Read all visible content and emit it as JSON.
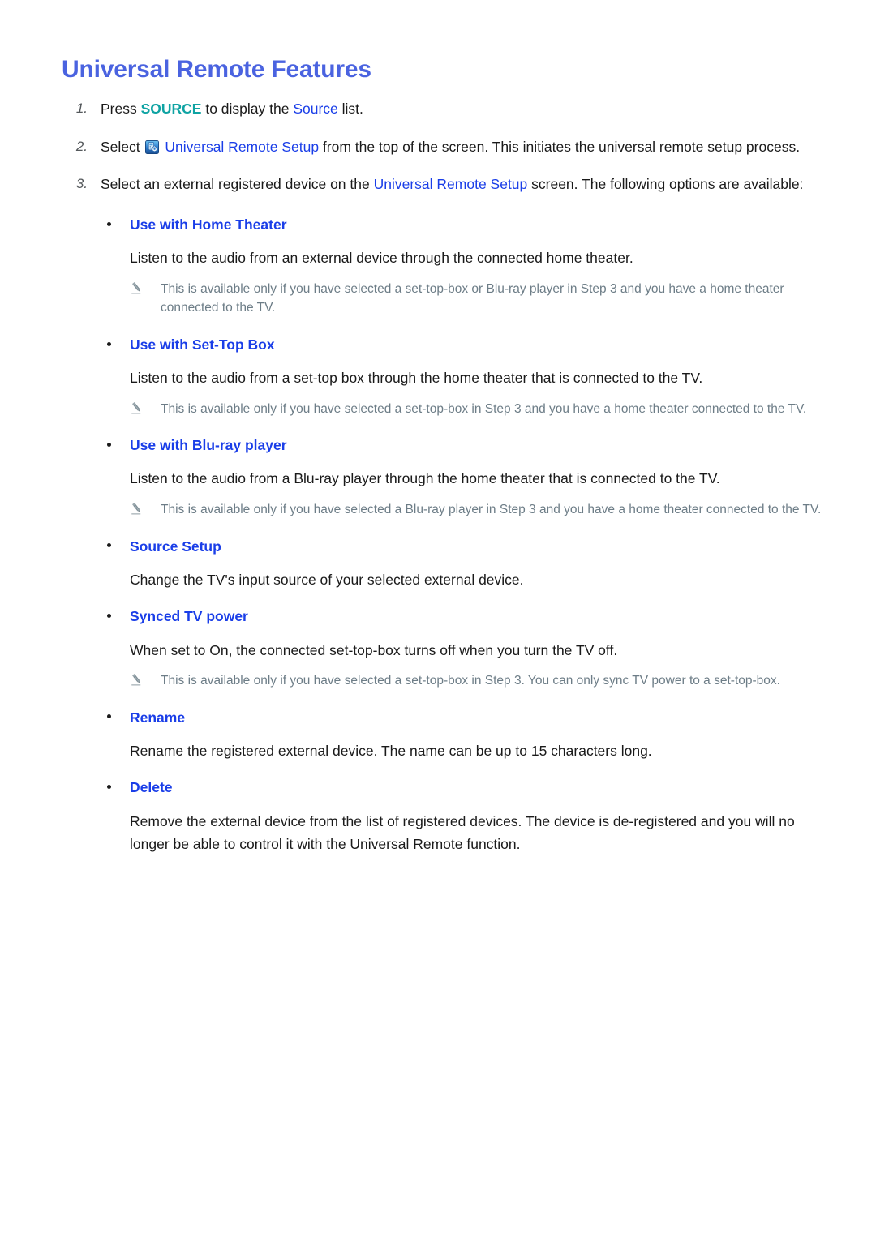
{
  "page": {
    "title": "Universal Remote Features"
  },
  "icons": {
    "setup": "universal-remote-setup-icon",
    "note": "pencil-note-icon",
    "bullet": "bullet-dot-icon"
  },
  "colors": {
    "title_blue": "#4a63e0",
    "link_blue": "#1a3ee8",
    "key_teal": "#0fa3a3",
    "note_gray": "#6d7d87",
    "body_black": "#1a1a1a"
  },
  "steps": [
    {
      "num": "1.",
      "parts": [
        {
          "text": "Press ",
          "style": "plain"
        },
        {
          "text": "SOURCE",
          "style": "teal"
        },
        {
          "text": " to display the ",
          "style": "plain"
        },
        {
          "text": "Source",
          "style": "blue"
        },
        {
          "text": " list.",
          "style": "plain"
        }
      ]
    },
    {
      "num": "2.",
      "parts": [
        {
          "text": "Select ",
          "style": "plain"
        },
        {
          "text": "",
          "style": "icon"
        },
        {
          "text": "Universal Remote Setup",
          "style": "blue"
        },
        {
          "text": " from the top of the screen. This initiates the universal remote setup process.",
          "style": "plain"
        }
      ]
    },
    {
      "num": "3.",
      "parts": [
        {
          "text": "Select an external registered device on the ",
          "style": "plain"
        },
        {
          "text": "Universal Remote Setup",
          "style": "blue"
        },
        {
          "text": " screen. The following options are available:",
          "style": "plain"
        }
      ]
    }
  ],
  "options": [
    {
      "heading": "Use with Home Theater",
      "body": "Listen to the audio from an external device through the connected home theater.",
      "note": "This is available only if you have selected a set-top-box or Blu-ray player in Step 3 and you have a home theater connected to the TV."
    },
    {
      "heading": "Use with Set-Top Box",
      "body": "Listen to the audio from a set-top box through the home theater that is connected to the TV.",
      "note": "This is available only if you have selected a set-top-box in Step 3 and you have a home theater connected to the TV."
    },
    {
      "heading": "Use with Blu-ray player",
      "body": "Listen to the audio from a Blu-ray player through the home theater that is connected to the TV.",
      "note": "This is available only if you have selected a Blu-ray player in Step 3 and you have a home theater connected to the TV."
    },
    {
      "heading": "Source Setup",
      "body": "Change the TV's input source of your selected external device.",
      "note": null
    },
    {
      "heading": "Synced TV power",
      "body": "When set to On, the connected set-top-box turns off when you turn the TV off.",
      "note": "This is available only if you have selected a set-top-box in Step 3. You can only sync TV power to a set-top-box."
    },
    {
      "heading": "Rename",
      "body": "Rename the registered external device. The name can be up to 15 characters long.",
      "note": null
    },
    {
      "heading": "Delete",
      "body": "Remove the external device from the list of registered devices. The device is de-registered and you will no longer be able to control it with the Universal Remote function.",
      "note": null
    }
  ]
}
